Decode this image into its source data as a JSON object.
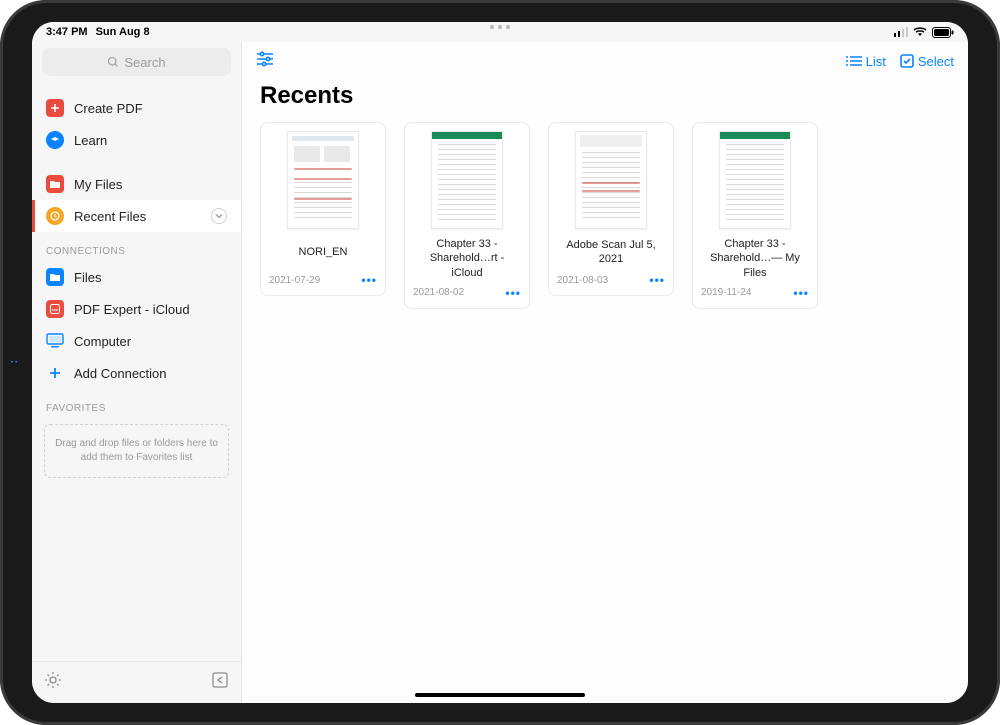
{
  "status": {
    "time": "3:47 PM",
    "date": "Sun Aug 8"
  },
  "search": {
    "placeholder": "Search"
  },
  "sidebar": {
    "top": [
      {
        "label": "Create PDF",
        "icon": "create-pdf-icon"
      },
      {
        "label": "Learn",
        "icon": "learn-icon"
      }
    ],
    "files": [
      {
        "label": "My Files",
        "icon": "myfiles-icon"
      },
      {
        "label": "Recent Files",
        "icon": "recent-icon"
      }
    ],
    "section_connections": "CONNECTIONS",
    "connections": [
      {
        "label": "Files",
        "icon": "files-icon"
      },
      {
        "label": "PDF Expert - iCloud",
        "icon": "pdfexpert-icloud-icon"
      },
      {
        "label": "Computer",
        "icon": "computer-icon"
      },
      {
        "label": "Add Connection",
        "icon": "plus-icon"
      }
    ],
    "section_favorites": "FAVORITES",
    "favorites_hint": "Drag and drop files or folders here to add them to Favorites list"
  },
  "toolbar": {
    "list_label": "List",
    "select_label": "Select"
  },
  "main": {
    "title": "Recents",
    "items": [
      {
        "title": "NORI_EN",
        "date": "2021-07-29",
        "thumb": "form"
      },
      {
        "title": "Chapter 33 - Sharehold…rt - iCloud",
        "date": "2021-08-02",
        "thumb": "green"
      },
      {
        "title": "Adobe Scan Jul 5, 2021",
        "date": "2021-08-03",
        "thumb": "scan"
      },
      {
        "title": "Chapter 33 - Sharehold…— My Files",
        "date": "2019-11-24",
        "thumb": "green"
      }
    ]
  }
}
